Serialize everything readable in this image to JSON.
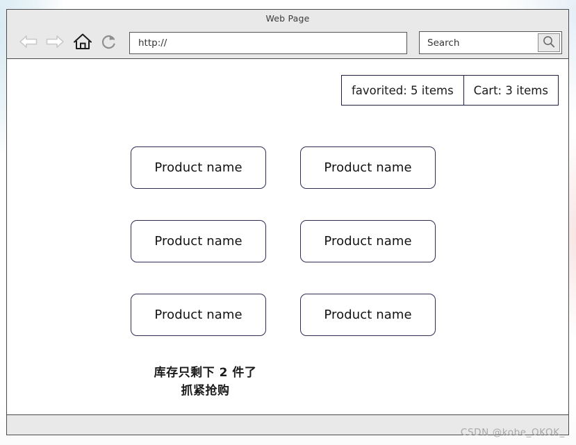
{
  "window": {
    "title": "Web Page"
  },
  "toolbar": {
    "back_icon": "arrow-left-icon",
    "forward_icon": "arrow-right-icon",
    "home_icon": "home-icon",
    "reload_icon": "reload-icon",
    "url_value": "http://",
    "url_placeholder": "http://",
    "search_value": "Search",
    "search_placeholder": "Search",
    "search_icon": "magnifier-icon"
  },
  "status_summary": {
    "favorited": "favorited: 5 items",
    "cart": "Cart: 3 items"
  },
  "products": [
    {
      "label": "Product name"
    },
    {
      "label": "Product name"
    },
    {
      "label": "Product name"
    },
    {
      "label": "Product name"
    },
    {
      "label": "Product name"
    },
    {
      "label": "Product name"
    }
  ],
  "stock_notice": {
    "line1": "库存只剩下 2 件了",
    "line2": "抓紧抢购"
  },
  "watermark": {
    "text": "CSDN @kobe_OKOK_"
  },
  "colors": {
    "chrome_bg": "#e9e9e9",
    "window_border": "#4a4a4a",
    "card_border": "#2c2c54",
    "text": "#1a1a1a",
    "icon_disabled": "#c4c4c4",
    "icon_muted": "#8f8f8f",
    "watermark": "#a8a8a8"
  }
}
